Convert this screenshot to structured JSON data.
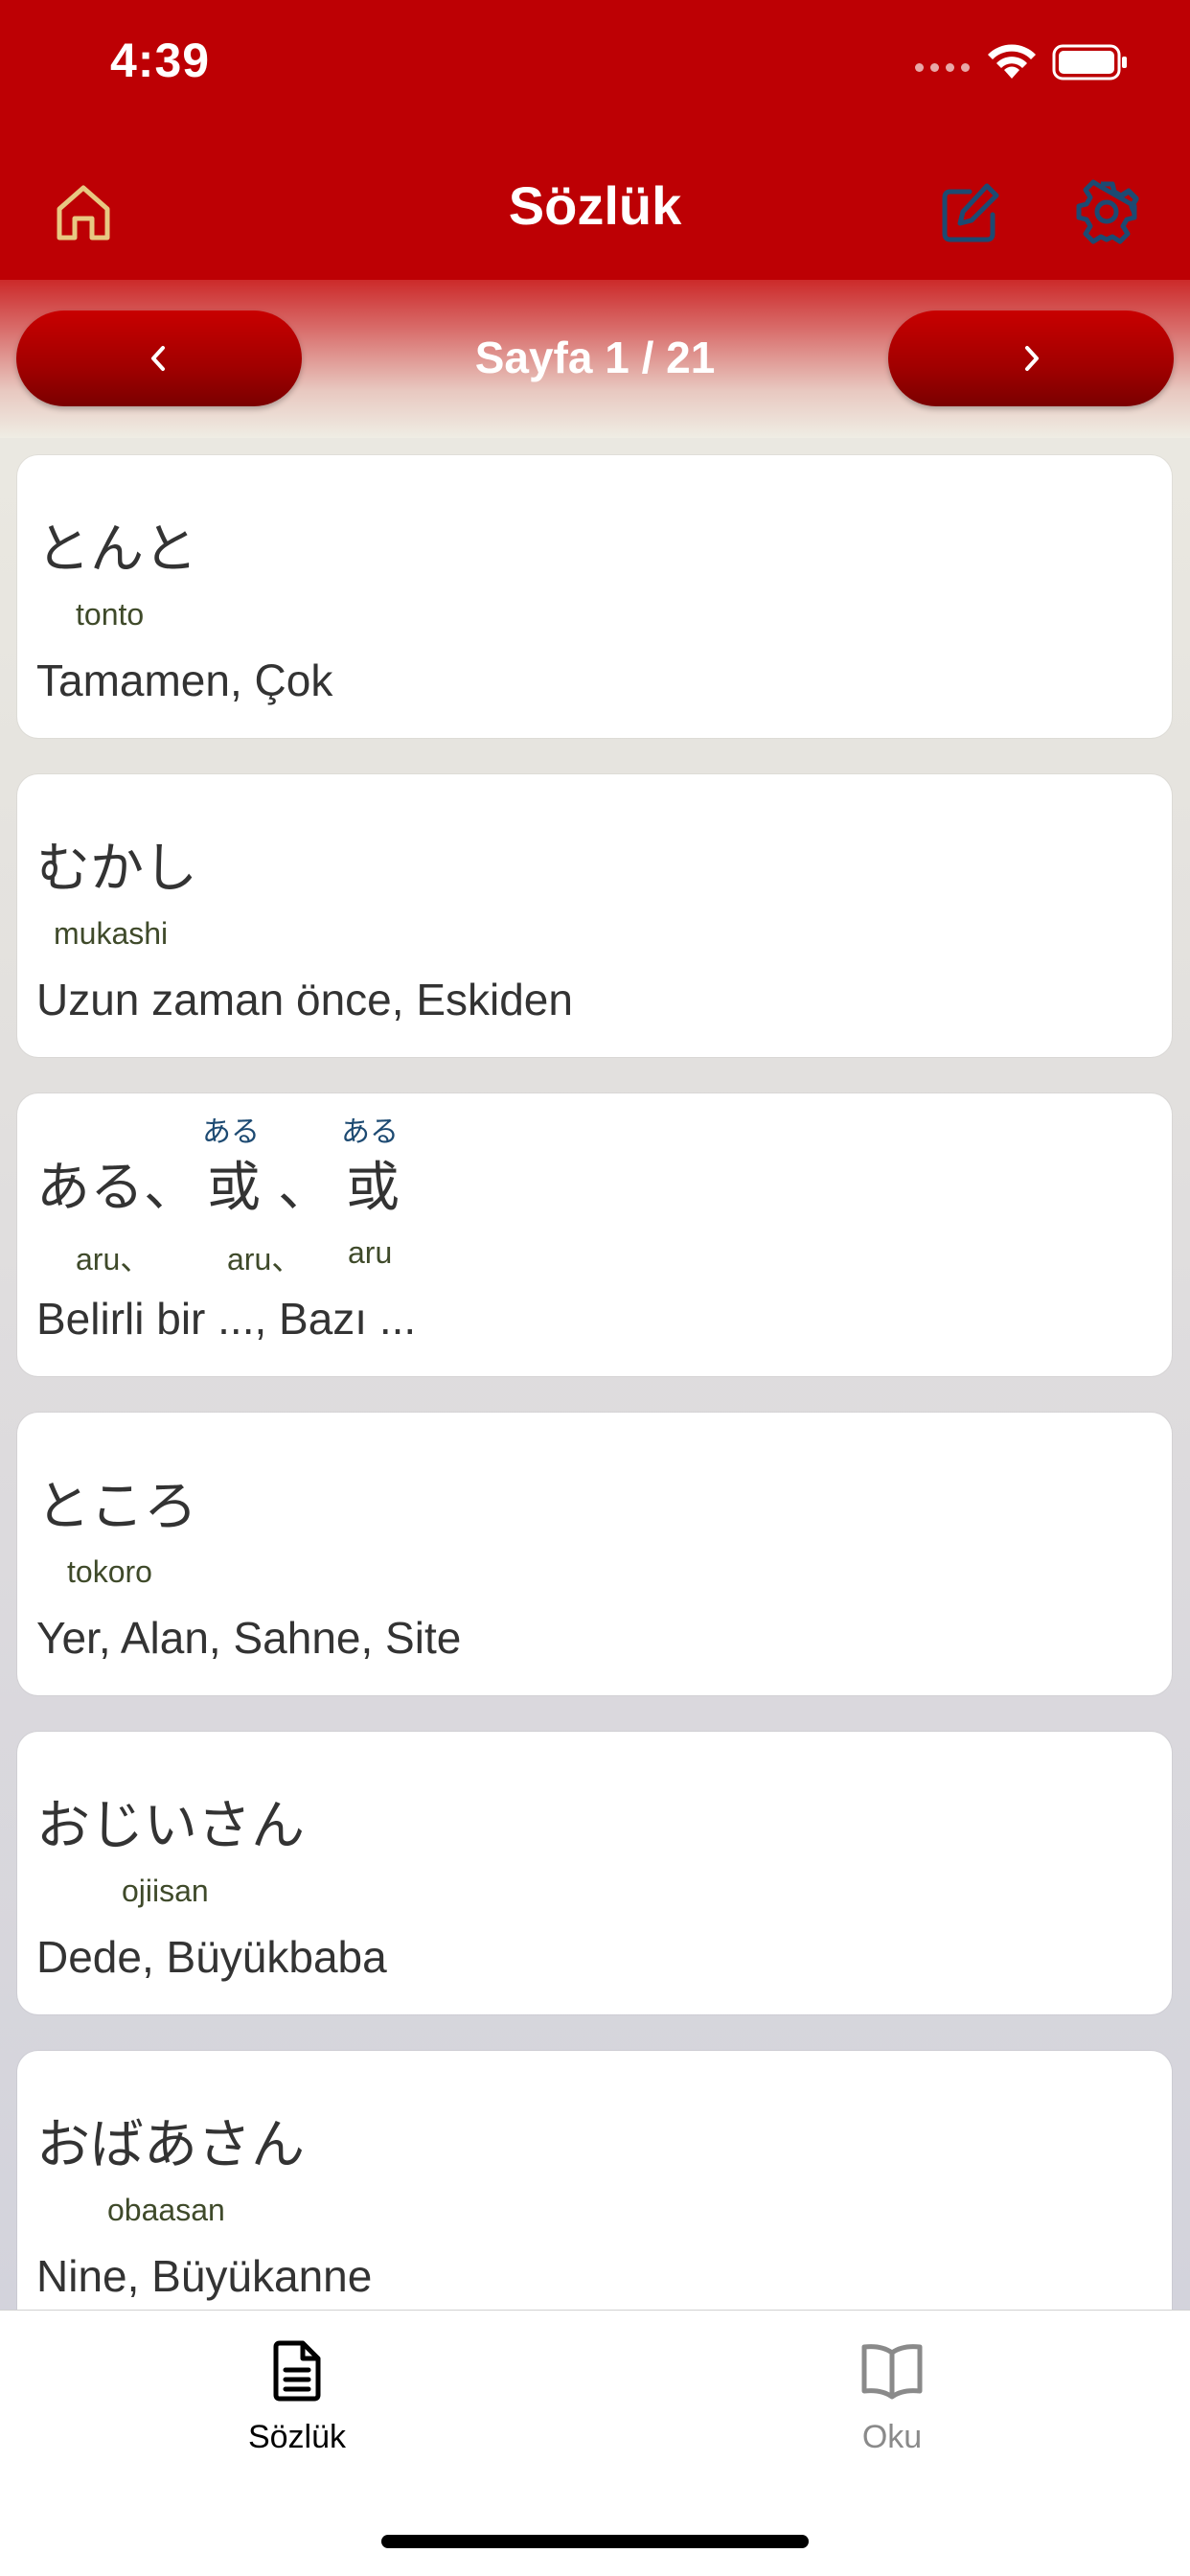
{
  "status_bar": {
    "time": "4:39"
  },
  "header": {
    "title": "Sözlük",
    "home_icon": "home-icon",
    "edit_icon": "edit-icon",
    "settings_icon": "gear-icon"
  },
  "pager": {
    "label": "Sayfa 1 / 21",
    "prev_glyph": "‹",
    "next_glyph": "›"
  },
  "colors": {
    "accent": "#bd0004",
    "icon_gold": "#e8c882",
    "icon_blue": "#1d4a72",
    "tab_active": "#000000",
    "tab_inactive": "#8a8a8a"
  },
  "entries": [
    {
      "kana": "とんと",
      "romaji": "tonto",
      "meaning": "Tamamen, Çok"
    },
    {
      "kana": "むかし",
      "romaji": "mukashi",
      "meaning": "Uzun zaman önce, Eskiden"
    },
    {
      "kana_parts": [
        "ある、",
        "或",
        "、",
        "或"
      ],
      "furigana": [
        "ある",
        "ある"
      ],
      "romaji_parts": [
        "aru、",
        "aru、",
        "aru"
      ],
      "meaning": "Belirli bir ..., Bazı ..."
    },
    {
      "kana": "ところ",
      "romaji": "tokoro",
      "meaning": "Yer, Alan, Sahne, Site"
    },
    {
      "kana": "おじいさん",
      "romaji": "ojiisan",
      "meaning": "Dede, Büyükbaba"
    },
    {
      "kana": "おばあさん",
      "romaji": "obaasan",
      "meaning": "Nine, Büyükanne"
    }
  ],
  "tabs": [
    {
      "label": "Sözlük",
      "icon": "document-icon",
      "active": true
    },
    {
      "label": "Oku",
      "icon": "book-icon",
      "active": false
    }
  ]
}
